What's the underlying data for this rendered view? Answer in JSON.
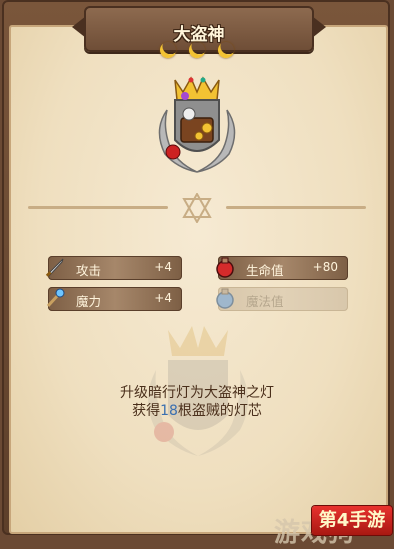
{
  "header": {
    "title": "大盗神",
    "rank_moons": 3
  },
  "stats": {
    "attack": {
      "label": "攻击",
      "value": "+4",
      "icon": "sword-icon"
    },
    "health": {
      "label": "生命值",
      "value": "+80",
      "icon": "red-potion-icon"
    },
    "magic": {
      "label": "魔力",
      "value": "+4",
      "icon": "magic-staff-icon"
    },
    "mana": {
      "label": "魔法值",
      "value": "",
      "icon": "blue-potion-icon",
      "state": "inactive"
    }
  },
  "upgrade": {
    "line1": "升级暗行灯为大盗神之灯",
    "line2_prefix": "获得",
    "line2_count": "18",
    "line2_suffix": "根盗贼的灯芯"
  },
  "watermark": {
    "text": "游戏狗"
  },
  "logo": {
    "text": "第4手游"
  },
  "colors": {
    "accent_gold": "#f2c233",
    "stat_bar": "#a6876a",
    "highlight_number": "#3a6fb0",
    "logo_red": "#e8322e"
  }
}
